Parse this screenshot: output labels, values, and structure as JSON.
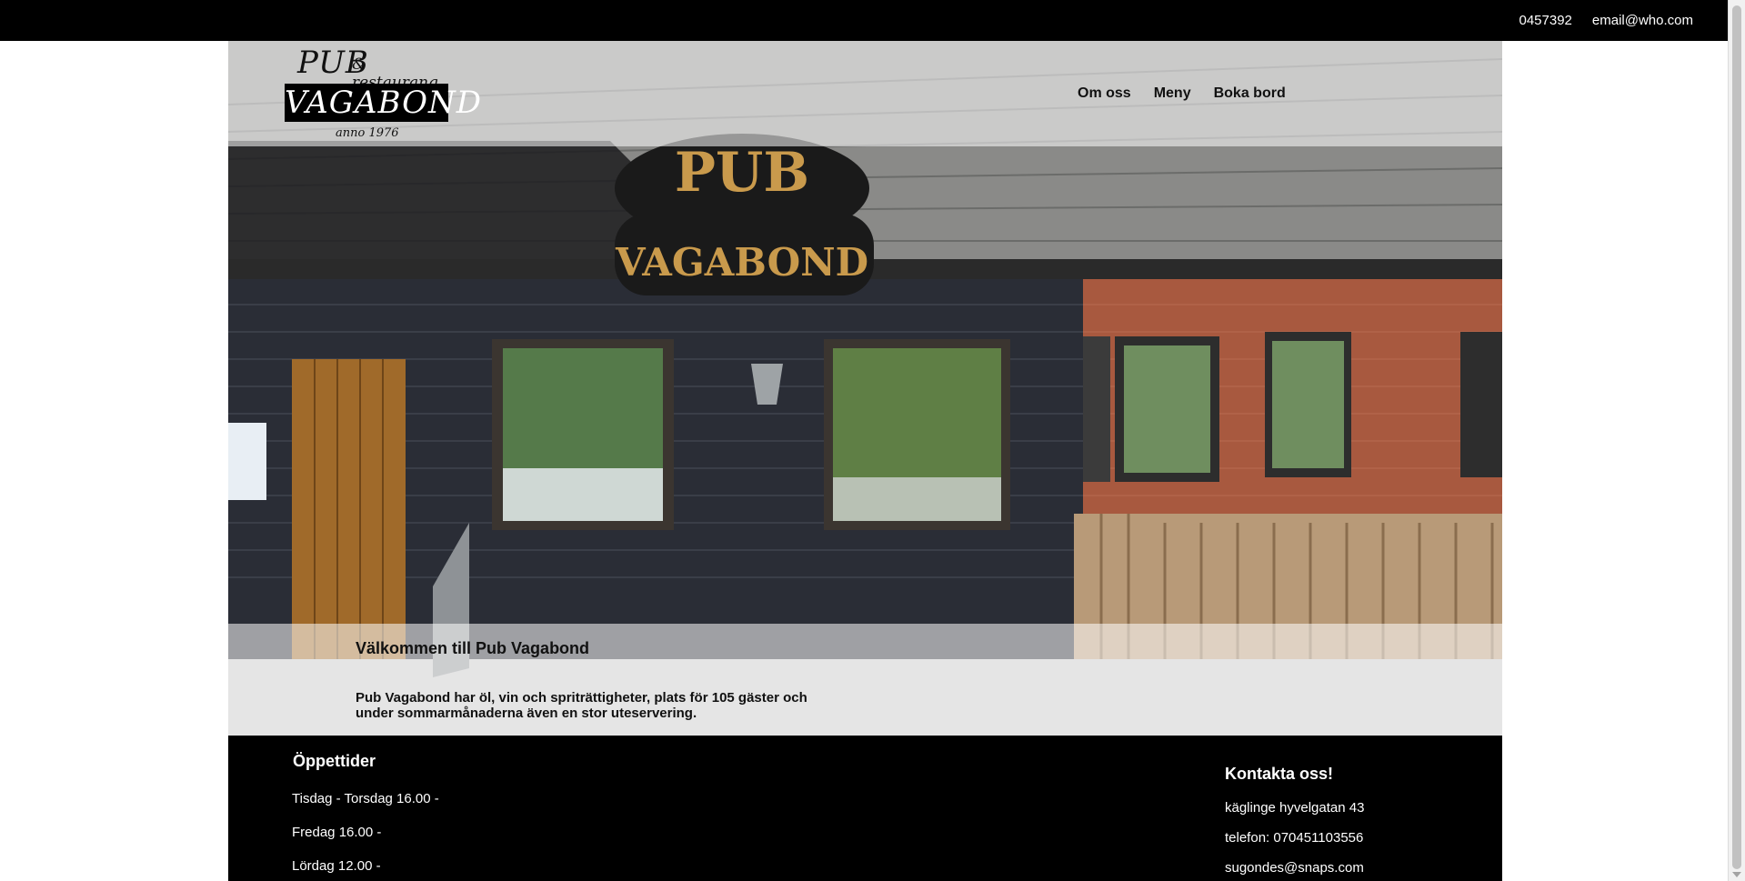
{
  "topbar": {
    "phone": "0457392",
    "email": "email@who.com"
  },
  "logo": {
    "pub": "PUB",
    "restaurant": "& restaurang",
    "name": "VAGABOND",
    "anno": "anno 1976"
  },
  "nav": {
    "items": [
      {
        "label": "Om oss"
      },
      {
        "label": "Meny"
      },
      {
        "label": "Boka bord"
      }
    ]
  },
  "hero": {
    "sign_top": "PUB",
    "sign_bottom": "VAGABOND",
    "heading": "Välkommen till Pub Vagabond",
    "text": "Pub Vagabond har öl, vin och spriträttigheter, plats för 105 gäster och under sommarmånaderna även en stor uteservering."
  },
  "footer": {
    "hours_title": "Öppettider",
    "hours": [
      "Tisdag - Torsdag 16.00 -",
      "Fredag 16.00 -",
      "Lördag 12.00 -"
    ],
    "contact_title": "Kontakta oss!",
    "address": "käglinge hyvelgatan 43",
    "phone": "telefon: 070451103556",
    "email": "sugondes@snaps.com"
  }
}
